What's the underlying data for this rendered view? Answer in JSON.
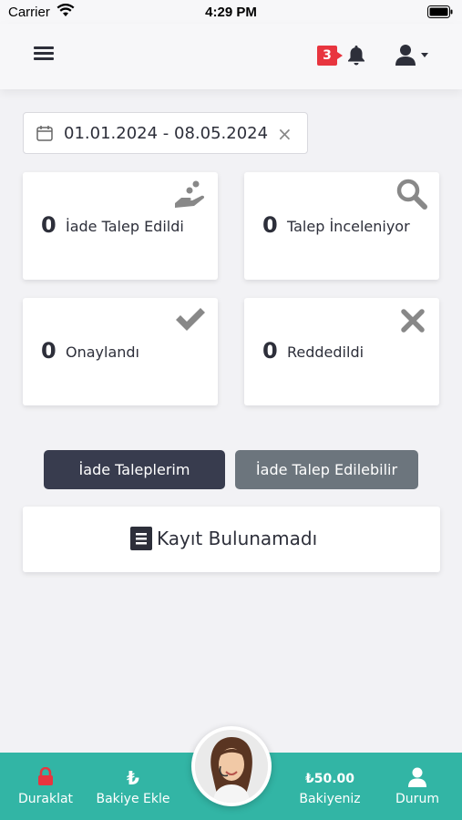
{
  "status_bar": {
    "carrier": "Carrier",
    "time": "4:29 PM"
  },
  "header": {
    "notification_count": "3",
    "menu_icon": "hamburger-icon",
    "bell_icon": "bell-icon",
    "user_icon": "user-icon"
  },
  "date_filter": {
    "value": "01.01.2024 - 08.05.2024",
    "clear": "×"
  },
  "stats": [
    {
      "count": "0",
      "label": "İade Talep Edildi",
      "icon": "hand-coins-icon"
    },
    {
      "count": "0",
      "label": "Talep İnceleniyor",
      "icon": "search-icon"
    },
    {
      "count": "0",
      "label": "Onaylandı",
      "icon": "check-icon"
    },
    {
      "count": "0",
      "label": "Reddedildi",
      "icon": "x-icon"
    }
  ],
  "tabs": {
    "active": "İade Taleplerim",
    "inactive": "İade Talep Edilebilir"
  },
  "empty_state": {
    "message": "Kayıt Bulunamadı"
  },
  "bottom_nav": {
    "pause": "Duraklat",
    "topup": "Bakiye Ekle",
    "topup_symbol": "₺",
    "balance_amount": "₺50.00",
    "balance_label": "Bakiyeniz",
    "status": "Durum"
  },
  "colors": {
    "accent": "#32b5a5",
    "badge": "#e8353f",
    "tab_active": "#383c4e",
    "tab_inactive": "#6c757d"
  }
}
